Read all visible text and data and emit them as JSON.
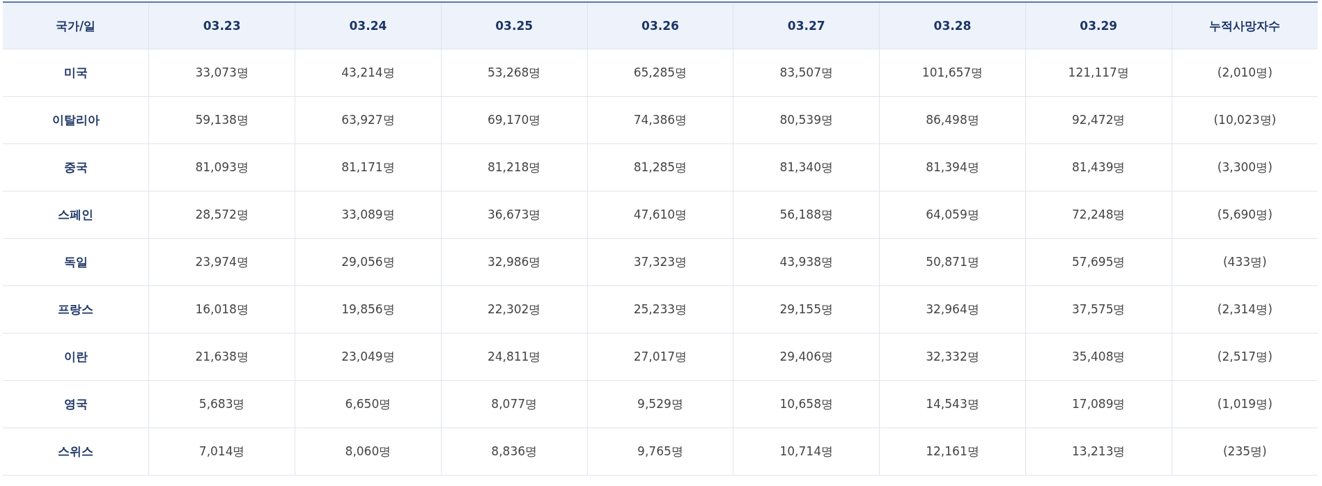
{
  "table": {
    "columns": [
      "국가/일",
      "03.23",
      "03.24",
      "03.25",
      "03.26",
      "03.27",
      "03.28",
      "03.29",
      "누적사망자수"
    ],
    "rows": [
      {
        "country": "미국",
        "values": [
          "33,073명",
          "43,214명",
          "53,268명",
          "65,285명",
          "83,507명",
          "101,657명",
          "121,117명"
        ],
        "deaths": "(2,010명)"
      },
      {
        "country": "이탈리아",
        "values": [
          "59,138명",
          "63,927명",
          "69,170명",
          "74,386명",
          "80,539명",
          "86,498명",
          "92,472명"
        ],
        "deaths": "(10,023명)"
      },
      {
        "country": "중국",
        "values": [
          "81,093명",
          "81,171명",
          "81,218명",
          "81,285명",
          "81,340명",
          "81,394명",
          "81,439명"
        ],
        "deaths": "(3,300명)"
      },
      {
        "country": "스페인",
        "values": [
          "28,572명",
          "33,089명",
          "36,673명",
          "47,610명",
          "56,188명",
          "64,059명",
          "72,248명"
        ],
        "deaths": "(5,690명)"
      },
      {
        "country": "독일",
        "values": [
          "23,974명",
          "29,056명",
          "32,986명",
          "37,323명",
          "43,938명",
          "50,871명",
          "57,695명"
        ],
        "deaths": "(433명)"
      },
      {
        "country": "프랑스",
        "values": [
          "16,018명",
          "19,856명",
          "22,302명",
          "25,233명",
          "29,155명",
          "32,964명",
          "37,575명"
        ],
        "deaths": "(2,314명)"
      },
      {
        "country": "이란",
        "values": [
          "21,638명",
          "23,049명",
          "24,811명",
          "27,017명",
          "29,406명",
          "32,332명",
          "35,408명"
        ],
        "deaths": "(2,517명)"
      },
      {
        "country": "영국",
        "values": [
          "5,683명",
          "6,650명",
          "8,077명",
          "9,529명",
          "10,658명",
          "14,543명",
          "17,089명"
        ],
        "deaths": "(1,019명)"
      },
      {
        "country": "스위스",
        "values": [
          "7,014명",
          "8,060명",
          "8,836명",
          "9,765명",
          "10,714명",
          "12,161명",
          "13,213명"
        ],
        "deaths": "(235명)"
      }
    ]
  }
}
